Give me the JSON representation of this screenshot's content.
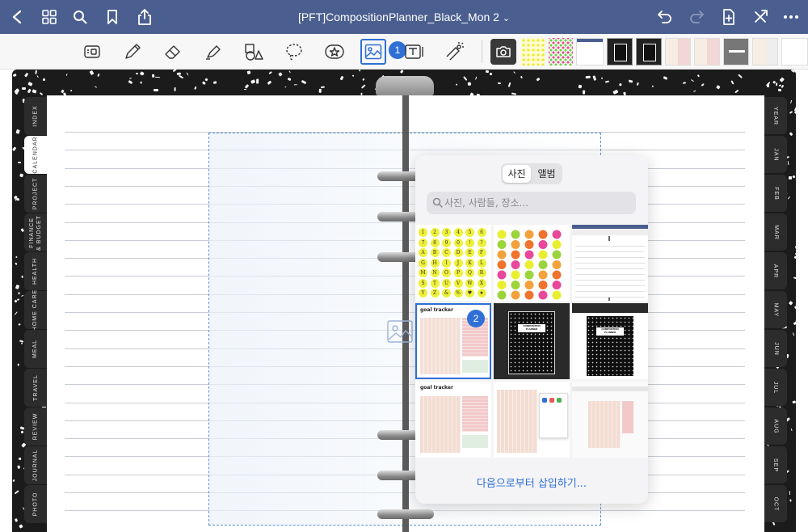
{
  "navbar": {
    "title": "[PFT]CompositionPlanner_Black_Mon 2",
    "title_chevron": "⌄",
    "icons": [
      "back-icon",
      "grid-icon",
      "search-icon",
      "bookmark-icon",
      "share-icon",
      "undo-icon",
      "redo-icon",
      "add-page-icon",
      "close-x-icon",
      "more-icon"
    ]
  },
  "toolbar": {
    "tools": [
      "keyboard-icon",
      "pen-icon",
      "eraser-icon",
      "highlighter-icon",
      "shapes-icon",
      "lasso-icon",
      "sticker-icon",
      "image-icon",
      "text-icon",
      "laser-pointer-icon",
      "camera-icon"
    ],
    "active_tool": "image-icon",
    "badge_1": "1"
  },
  "left_tabs": [
    "INDEX",
    "CALENDAR",
    "PROJECT",
    "FINANCE & BUDGET",
    "HEALTH",
    "HOME CARE",
    "MEAL",
    "TRAVEL",
    "REVIEW",
    "JOURNAL",
    "PHOTO"
  ],
  "active_left_tab": "CALENDAR",
  "right_tabs": [
    "YEAR",
    "JAN",
    "FEB",
    "MAR",
    "APR",
    "MAY",
    "JUN",
    "JUL",
    "AUG",
    "SEP",
    "OCT"
  ],
  "picker": {
    "tab_photos": "사진",
    "tab_albums": "앨범",
    "search_placeholder": "사진, 사람들, 장소...",
    "badge_2": "2",
    "insert_from": "다음으로부터 삽입하기...",
    "thumb_goal_title": "goal tracker",
    "thumb_notebook_label": "COMPOSITION PLANNER",
    "sticker_rows": [
      [
        "1",
        "2",
        "3",
        "4",
        "5",
        "6"
      ],
      [
        "7",
        "8",
        "9",
        "0",
        "!",
        "?"
      ],
      [
        "A",
        "B",
        "C",
        "D",
        "E",
        "F"
      ],
      [
        "G",
        "H",
        "I",
        "J",
        "K",
        "L"
      ],
      [
        "M",
        "N",
        "O",
        "P",
        "Q",
        "R"
      ],
      [
        "S",
        "T",
        "U",
        "V",
        "W",
        "X"
      ],
      [
        "Y",
        "Z",
        "&",
        "%",
        "♥",
        "★"
      ]
    ]
  },
  "colors": {
    "navbar": "#4a5f8f",
    "accent": "#2f6fd6",
    "cover": "#1b1b1b",
    "sticker_yellow": "#eef03a"
  }
}
